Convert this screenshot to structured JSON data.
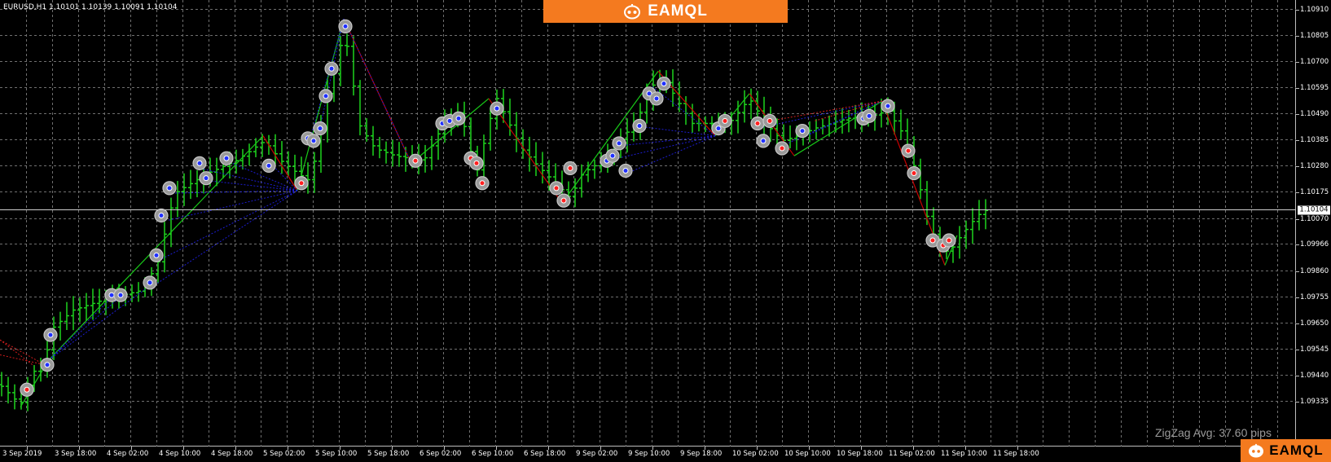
{
  "chart": {
    "symbol_info": "EURUSD,H1  1.10101 1.10139 1.10091 1.10104",
    "current_price": "1.10104",
    "zigzag_label": "ZigZag Avg: 37.60 pips",
    "price_labels": [
      "1.10910",
      "1.10805",
      "1.10700",
      "1.10595",
      "1.10490",
      "1.10385",
      "1.10280",
      "1.10175",
      "1.10070",
      "1.09966",
      "1.09860",
      "1.09755",
      "1.09650",
      "1.09545",
      "1.09440",
      "1.09335"
    ],
    "time_labels": [
      "3 Sep 2019",
      "3 Sep 18:00",
      "4 Sep 02:00",
      "4 Sep 10:00",
      "4 Sep 18:00",
      "5 Sep 02:00",
      "5 Sep 10:00",
      "5 Sep 18:00",
      "6 Sep 02:00",
      "6 Sep 10:00",
      "6 Sep 18:00",
      "9 Sep 02:00",
      "9 Sep 10:00",
      "9 Sep 18:00",
      "10 Sep 02:00",
      "10 Sep 10:00",
      "10 Sep 18:00",
      "11 Sep 02:00",
      "11 Sep 10:00",
      "11 Sep 18:00"
    ],
    "colors": {
      "background": "#000000",
      "grid": "#6f6f6f",
      "bar": "#1ed41e",
      "zigzag_up": "#18c818",
      "zigzag_down": "#c80000",
      "fan_blue": "#1c1cd0",
      "fan_red": "#d01c1c",
      "marker_ring": "#c8c8c8",
      "brand": "#f47a1f"
    }
  },
  "banner": {
    "brand_text": "EAMQL",
    "icon": "robot-icon"
  }
}
